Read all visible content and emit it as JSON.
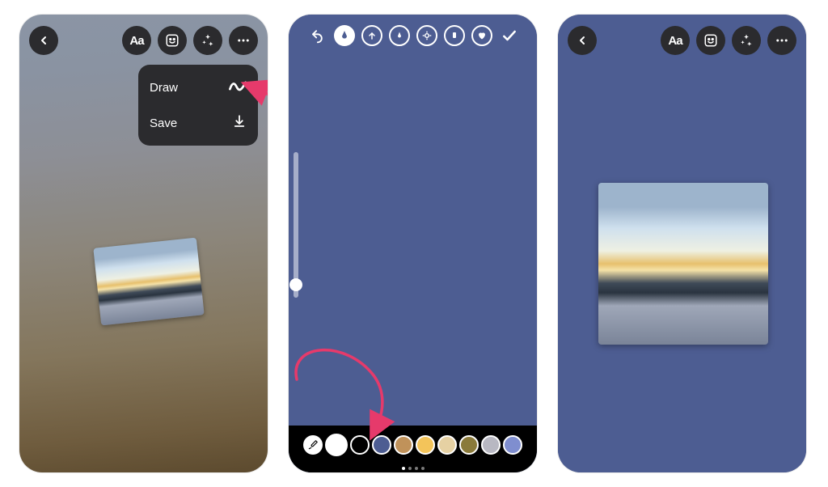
{
  "menu": {
    "draw_label": "Draw",
    "save_label": "Save"
  },
  "toolbar": {
    "text_label": "Aa"
  },
  "colors": {
    "swatches": [
      "#ffffff",
      "#000000",
      "#4d5d92",
      "#c0925a",
      "#f3c45a",
      "#e6d1a3",
      "#8a7a3a",
      "#b8b8c2",
      "#7f8ecf"
    ],
    "selected_index": 0,
    "accent": "#e63a6b",
    "solid_bg": "#4d5d92"
  },
  "pager": {
    "count": 4,
    "active": 0
  }
}
